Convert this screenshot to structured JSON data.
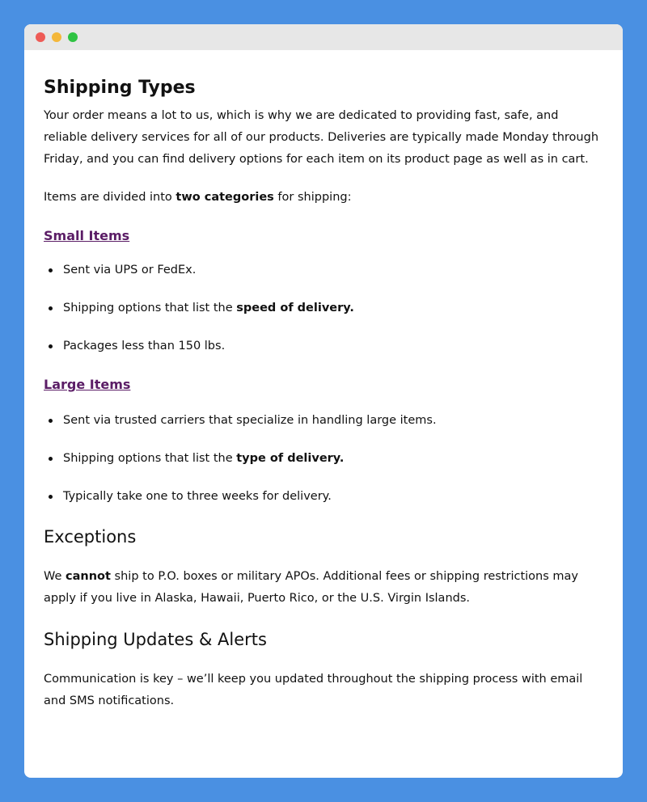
{
  "window": {
    "dot_colors": [
      "#ee5b56",
      "#f4b73a",
      "#2fc343"
    ]
  },
  "shipping_types": {
    "title": "Shipping Types",
    "intro": "Your order means a lot to us, which is why we are dedicated to providing fast, safe, and reliable delivery services for all of our products. Deliveries are typically made Monday through Friday, and you can find delivery options for each item on its product page as well as in cart.",
    "categories_pre": "Items are divided into ",
    "categories_bold": "two categories",
    "categories_post": " for shipping:"
  },
  "small_items": {
    "heading": "Small Items",
    "bullets": [
      {
        "text": "Sent via UPS or FedEx.",
        "bold": ""
      },
      {
        "text": "Shipping options that list the ",
        "bold": "speed of delivery."
      },
      {
        "text": "Packages less than 150 lbs.",
        "bold": ""
      }
    ]
  },
  "large_items": {
    "heading": "Large Items",
    "bullets": [
      {
        "text": "Sent via trusted carriers that specialize in handling large items.",
        "bold": ""
      },
      {
        "text": "Shipping options that list the ",
        "bold": "type of delivery."
      },
      {
        "text": "Typically take one to three weeks for delivery.",
        "bold": ""
      }
    ]
  },
  "exceptions": {
    "title": "Exceptions",
    "pre": "We ",
    "bold": "cannot",
    "post": " ship to P.O. boxes or military APOs. Additional fees or shipping restrictions may apply if you live in Alaska, Hawaii, Puerto Rico, or the U.S. Virgin Islands."
  },
  "updates": {
    "title": "Shipping Updates & Alerts",
    "text": "Communication is key – we’ll keep you updated throughout the shipping process with email and SMS notifications."
  }
}
